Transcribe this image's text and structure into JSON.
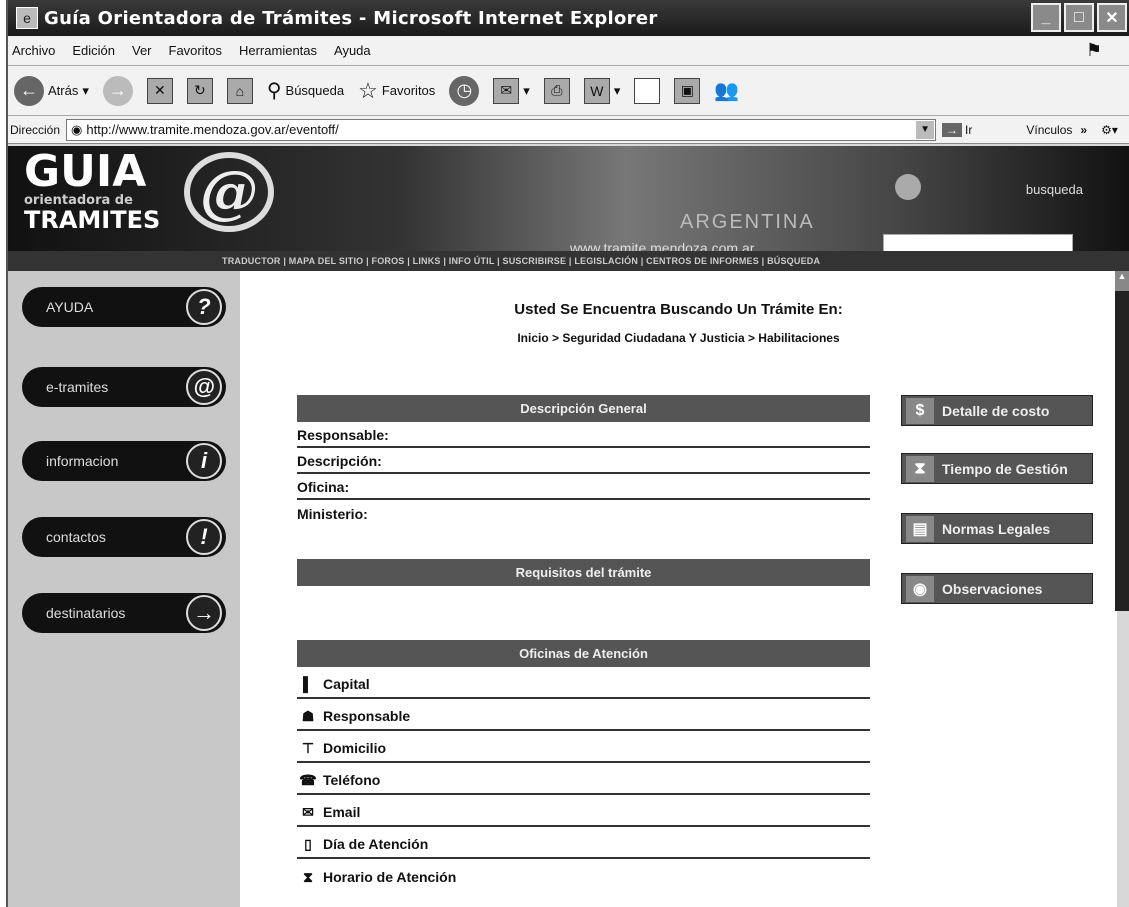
{
  "window": {
    "title": "Guía Orientadora de Trámites - Microsoft Internet Explorer"
  },
  "menu": [
    "Archivo",
    "Edición",
    "Ver",
    "Favoritos",
    "Herramientas",
    "Ayuda"
  ],
  "toolbar": {
    "back": "Atrás",
    "search": "Búsqueda",
    "favorites": "Favoritos"
  },
  "address": {
    "label": "Dirección",
    "url": "http://www.tramite.mendoza.gov.ar/eventoff/",
    "go": "Ir",
    "links": "Vínculos"
  },
  "banner": {
    "logo_top": "GUIA",
    "logo_mid": "orientadora de",
    "logo_bottom": "TRAMITES",
    "country": "ARGENTINA",
    "site": "www.tramite.mendoza.com.ar",
    "search_label": "busqueda"
  },
  "nav_strip": "TRADUCTOR | MAPA DEL SITIO | FOROS | LINKS | INFO ÚTIL | SUSCRIBIRSE | LEGISLACIÓN | CENTROS DE INFORMES | BÚSQUEDA",
  "sidebar": [
    {
      "label": "AYUDA",
      "icon": "?"
    },
    {
      "label": "e-tramites",
      "icon": "@"
    },
    {
      "label": "informacion",
      "icon": "i"
    },
    {
      "label": "contactos",
      "icon": "!"
    },
    {
      "label": "destinatarios",
      "icon": "→"
    }
  ],
  "main": {
    "heading": "Usted Se Encuentra Buscando Un Trámite En:",
    "breadcrumb": "Inicio > Seguridad Ciudadana Y Justicia > Habilitaciones",
    "general_title": "Descripción General",
    "general_rows": [
      "Responsable:",
      "Descripción:",
      "Oficina:",
      "Ministerio:"
    ],
    "requisitos_title": "Requisitos del trámite",
    "oficinas_title": "Oficinas de Atención",
    "oficinas_rows": [
      "Capital",
      "Responsable",
      "Domicilio",
      "Teléfono",
      "Email",
      "Día de Atención",
      "Horario de Atención"
    ]
  },
  "side_buttons": [
    "Detalle de costo",
    "Tiempo de Gestión",
    "Normas Legales",
    "Observaciones"
  ],
  "colors": {
    "bar": "#555555",
    "sidebar": "#c8c8c8",
    "banner": "#333333"
  }
}
